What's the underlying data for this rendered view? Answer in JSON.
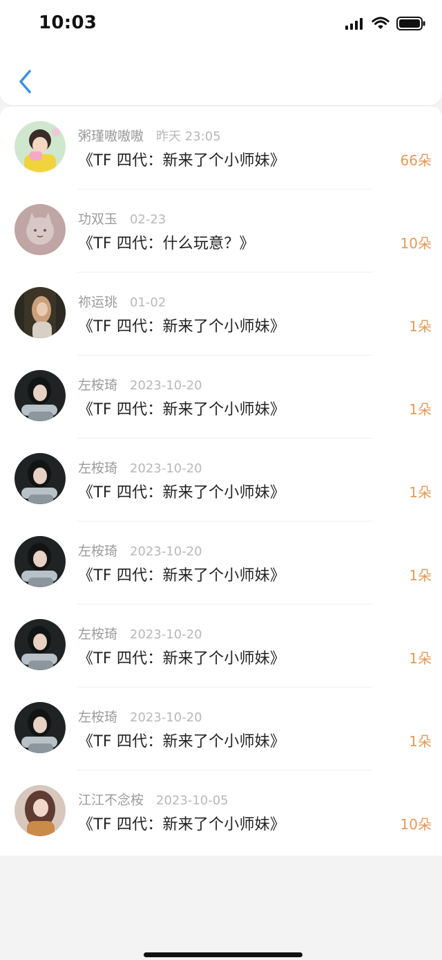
{
  "status_bar": {
    "time": "10:03",
    "icons": [
      "signal-icon",
      "wifi-icon",
      "battery-icon"
    ]
  },
  "nav": {
    "back_icon": "chevron-left-icon"
  },
  "colors": {
    "accent": "#e39a57",
    "back": "#3a8ee6",
    "name": "#9a9a9a",
    "time": "#b8b8b8",
    "title": "#222222"
  },
  "items": [
    {
      "name": "粥瑾嗷嗷嗷",
      "time": "昨天 23:05",
      "title": "《TF 四代：新来了个小师妹》",
      "amount": "66朵",
      "avatar": "avatar-cartoon-girl"
    },
    {
      "name": "功双玉",
      "time": "02-23",
      "title": "《TF 四代：什么玩意？》",
      "amount": "10朵",
      "avatar": "avatar-cat-illustration"
    },
    {
      "name": "祢运珧",
      "time": "01-02",
      "title": "《TF 四代：新来了个小师妹》",
      "amount": "1朵",
      "avatar": "avatar-photo-blonde"
    },
    {
      "name": "左桉琦",
      "time": "2023-10-20",
      "title": "《TF 四代：新来了个小师妹》",
      "amount": "1朵",
      "avatar": "avatar-photo-dark"
    },
    {
      "name": "左桉琦",
      "time": "2023-10-20",
      "title": "《TF 四代：新来了个小师妹》",
      "amount": "1朵",
      "avatar": "avatar-photo-dark"
    },
    {
      "name": "左桉琦",
      "time": "2023-10-20",
      "title": "《TF 四代：新来了个小师妹》",
      "amount": "1朵",
      "avatar": "avatar-photo-dark"
    },
    {
      "name": "左桉琦",
      "time": "2023-10-20",
      "title": "《TF 四代：新来了个小师妹》",
      "amount": "1朵",
      "avatar": "avatar-photo-dark"
    },
    {
      "name": "左桉琦",
      "time": "2023-10-20",
      "title": "《TF 四代：新来了个小师妹》",
      "amount": "1朵",
      "avatar": "avatar-photo-dark"
    },
    {
      "name": "江江不念桉",
      "time": "2023-10-05",
      "title": "《TF 四代：新来了个小师妹》",
      "amount": "10朵",
      "avatar": "avatar-photo-warm"
    }
  ]
}
